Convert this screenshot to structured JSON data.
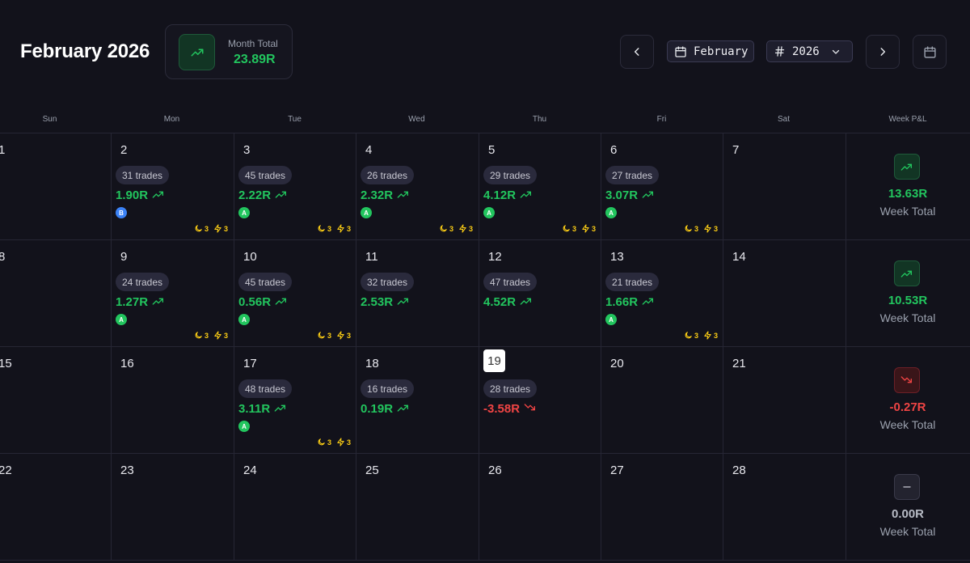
{
  "header": {
    "title": "February 2026",
    "month_total_label": "Month Total",
    "month_total_value": "23.89R",
    "month_select": "February",
    "year_select": "2026"
  },
  "weekdays": [
    "Sun",
    "Mon",
    "Tue",
    "Wed",
    "Thu",
    "Fri",
    "Sat",
    "Week P&L"
  ],
  "weeks": [
    {
      "days": [
        {
          "num": "1"
        },
        {
          "num": "2",
          "trades": "31 trades",
          "pnl": "1.90R",
          "dir": "up",
          "grade": "B",
          "flags": [
            "3",
            "3"
          ]
        },
        {
          "num": "3",
          "trades": "45 trades",
          "pnl": "2.22R",
          "dir": "up",
          "grade": "A",
          "flags": [
            "3",
            "3"
          ]
        },
        {
          "num": "4",
          "trades": "26 trades",
          "pnl": "2.32R",
          "dir": "up",
          "grade": "A",
          "flags": [
            "3",
            "3"
          ]
        },
        {
          "num": "5",
          "trades": "29 trades",
          "pnl": "4.12R",
          "dir": "up",
          "grade": "A",
          "flags": [
            "3",
            "3"
          ]
        },
        {
          "num": "6",
          "trades": "27 trades",
          "pnl": "3.07R",
          "dir": "up",
          "grade": "A",
          "flags": [
            "3",
            "3"
          ]
        },
        {
          "num": "7"
        }
      ],
      "total": "13.63R",
      "dir": "up",
      "label": "Week Total"
    },
    {
      "days": [
        {
          "num": "8"
        },
        {
          "num": "9",
          "trades": "24 trades",
          "pnl": "1.27R",
          "dir": "up",
          "grade": "A",
          "flags": [
            "3",
            "3"
          ]
        },
        {
          "num": "10",
          "trades": "45 trades",
          "pnl": "0.56R",
          "dir": "up",
          "grade": "A",
          "flags": [
            "3",
            "3"
          ]
        },
        {
          "num": "11",
          "trades": "32 trades",
          "pnl": "2.53R",
          "dir": "up"
        },
        {
          "num": "12",
          "trades": "47 trades",
          "pnl": "4.52R",
          "dir": "up"
        },
        {
          "num": "13",
          "trades": "21 trades",
          "pnl": "1.66R",
          "dir": "up",
          "grade": "A",
          "flags": [
            "3",
            "3"
          ]
        },
        {
          "num": "14"
        }
      ],
      "total": "10.53R",
      "dir": "up",
      "label": "Week Total"
    },
    {
      "days": [
        {
          "num": "15"
        },
        {
          "num": "16"
        },
        {
          "num": "17",
          "trades": "48 trades",
          "pnl": "3.11R",
          "dir": "up",
          "grade": "A",
          "flags": [
            "3",
            "3"
          ]
        },
        {
          "num": "18",
          "trades": "16 trades",
          "pnl": "0.19R",
          "dir": "up"
        },
        {
          "num": "19",
          "today": true,
          "trades": "28 trades",
          "pnl": "-3.58R",
          "dir": "down"
        },
        {
          "num": "20"
        },
        {
          "num": "21"
        }
      ],
      "total": "-0.27R",
      "dir": "down",
      "label": "Week Total"
    },
    {
      "days": [
        {
          "num": "22"
        },
        {
          "num": "23"
        },
        {
          "num": "24"
        },
        {
          "num": "25"
        },
        {
          "num": "26"
        },
        {
          "num": "27"
        },
        {
          "num": "28"
        }
      ],
      "total": "0.00R",
      "dir": "flat",
      "label": "Week Total"
    }
  ],
  "colors": {
    "positive": "#22c55e",
    "negative": "#ef4444",
    "flag": "#facc15",
    "grade_a": "#22c55e",
    "grade_b": "#3b82f6"
  }
}
